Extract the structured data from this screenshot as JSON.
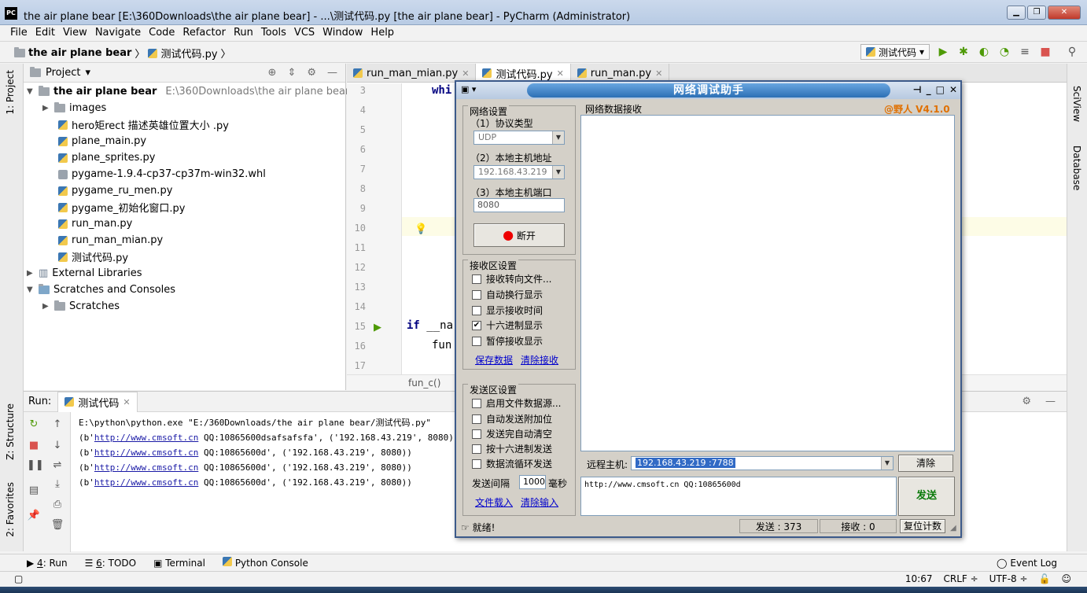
{
  "window": {
    "title": "the air plane bear [E:\\360Downloads\\the air plane bear] - ...\\测试代码.py [the air plane bear] - PyCharm (Administrator)",
    "logo": "PC"
  },
  "menu": [
    "File",
    "Edit",
    "View",
    "Navigate",
    "Code",
    "Refactor",
    "Run",
    "Tools",
    "VCS",
    "Window",
    "Help"
  ],
  "breadcrumb": {
    "project": "the air plane bear",
    "file": "测试代码.py"
  },
  "run_config": "测试代码",
  "left_tabs": {
    "project": "1: Project",
    "structure": "Z: Structure",
    "favorites": "2: Favorites"
  },
  "right_tabs": {
    "sciview": "SciView",
    "database": "Database"
  },
  "project_panel": {
    "title": "Project",
    "root": {
      "name": "the air plane bear",
      "path": "E:\\360Downloads\\the air plane bear"
    },
    "items": [
      "images",
      "hero矩rect  描述英雄位置大小 .py",
      "plane_main.py",
      "plane_sprites.py",
      "pygame-1.9.4-cp37-cp37m-win32.whl",
      "pygame_ru_men.py",
      "pygame_初始化窗口.py",
      "run_man.py",
      "run_man_mian.py",
      "测试代码.py"
    ],
    "external": "External Libraries",
    "scratches_root": "Scratches and Consoles",
    "scratches": "Scratches"
  },
  "editor": {
    "tabs": [
      "run_man_mian.py",
      "测试代码.py",
      "run_man.py"
    ],
    "line_numbers": [
      "3",
      "4",
      "5",
      "6",
      "7",
      "8",
      "9",
      "10",
      "11",
      "12",
      "13",
      "14",
      "15",
      "16",
      "17"
    ],
    "code": {
      "line3": "whi",
      "line15_kw": "if",
      "line15_rest": " __na",
      "line16": "fun"
    },
    "crumb": "fun_c()"
  },
  "run_panel": {
    "label": "Run:",
    "tab": "测试代码",
    "cmd": "E:\\python\\python.exe \"E:/360Downloads/the air plane bear/测试代码.py\"",
    "lines": [
      {
        "prefix": "(b'",
        "link": "http://www.cmsoft.cn",
        "rest": " QQ:10865600dsafsafsfa', ('192.168.43.219', 8080))"
      },
      {
        "prefix": "(b'",
        "link": "http://www.cmsoft.cn",
        "rest": " QQ:10865600d', ('192.168.43.219', 8080))"
      },
      {
        "prefix": "(b'",
        "link": "http://www.cmsoft.cn",
        "rest": " QQ:10865600d', ('192.168.43.219', 8080))"
      },
      {
        "prefix": "(b'",
        "link": "http://www.cmsoft.cn",
        "rest": " QQ:10865600d', ('192.168.43.219', 8080))"
      }
    ]
  },
  "bottom_tools": {
    "run_num": "4",
    "run": ": Run",
    "todo_num": "6",
    "todo": ": TODO",
    "terminal": "Terminal",
    "python_console": "Python Console",
    "event_log": "Event Log"
  },
  "status": {
    "position": "10:67",
    "line_sep": "CRLF ÷",
    "encoding": "UTF-8 ÷"
  },
  "dialog": {
    "title": "网络调试助手",
    "version": "@野人 V4.1.0",
    "net_settings": "网络设置",
    "proto_label": "（1）协议类型",
    "proto_value": "UDP",
    "host_label": "（2）本地主机地址",
    "host_value": "192.168.43.219",
    "port_label": "（3）本地主机端口",
    "port_value": "8080",
    "disconnect": "断开",
    "recv_settings": "接收区设置",
    "recv_opts": [
      "接收转向文件...",
      "自动换行显示",
      "显示接收时间",
      "十六进制显示",
      "暂停接收显示"
    ],
    "save_data": "保存数据",
    "clear_recv": "清除接收",
    "send_settings": "发送区设置",
    "send_opts": [
      "启用文件数据源...",
      "自动发送附加位",
      "发送完自动清空",
      "按十六进制发送",
      "数据流循环发送"
    ],
    "interval_label": "发送间隔",
    "interval_value": "1000",
    "interval_unit": "毫秒",
    "file_load": "文件载入",
    "clear_input": "清除输入",
    "recv_area_label": "网络数据接收",
    "remote_label": "远程主机:",
    "remote_value": "192.168.43.219 :7788",
    "clear_btn": "清除",
    "send_text": "http://www.cmsoft.cn QQ:10865600d",
    "send_btn": "发送",
    "ready": "就绪!",
    "sent_label": "发送 : 373",
    "recv_count_label": "接收 : 0",
    "reset": "复位计数"
  }
}
